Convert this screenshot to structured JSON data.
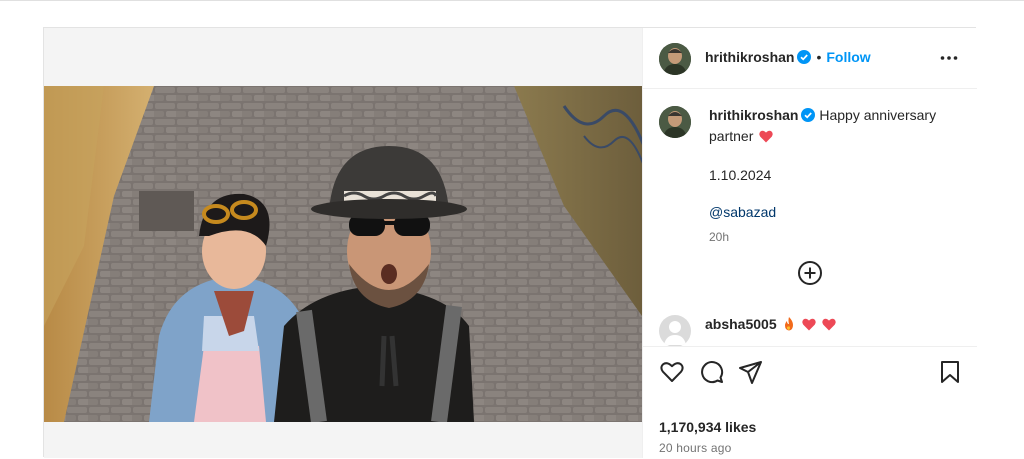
{
  "post": {
    "author": {
      "username": "hrithikroshan",
      "verified": true,
      "follow_label": "Follow",
      "separator": "•"
    },
    "caption": {
      "username": "hrithikroshan",
      "text": "Happy anniversary partner",
      "date": "1.10.2024",
      "mention": "@sabazad",
      "time": "20h"
    },
    "comment": {
      "username": "absha5005",
      "emojis": [
        "fire-icon",
        "heart-icon",
        "heart-icon"
      ]
    },
    "likes": "1,170,934 likes",
    "posted_ago": "20 hours ago",
    "icons": [
      "like-heart-icon",
      "comment-bubble-icon",
      "share-send-icon",
      "bookmark-icon",
      "add-comment-icon",
      "more-options-icon",
      "verified-badge-icon"
    ]
  },
  "colors": {
    "accent": "#0095f6",
    "mention": "#00376b",
    "heart": "#ed4956",
    "muted": "#737373"
  }
}
